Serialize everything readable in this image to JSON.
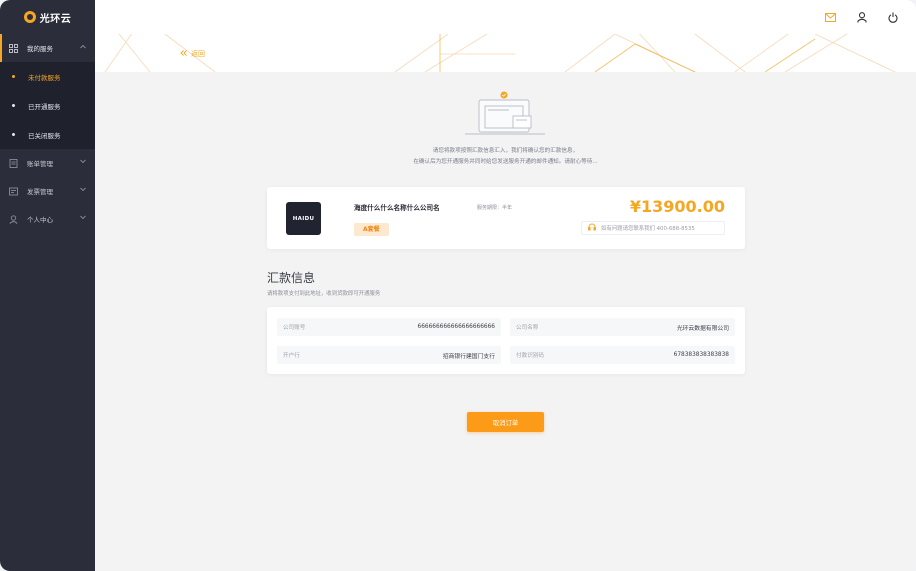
{
  "app": {
    "logo_text": "光环云"
  },
  "sidebar": {
    "groups": [
      {
        "label": "我的服务",
        "icon": "grid-icon",
        "open": true,
        "items": [
          {
            "label": "未付款服务",
            "active": true
          },
          {
            "label": "已开通服务",
            "active": false
          },
          {
            "label": "已关闭服务",
            "active": false
          }
        ]
      },
      {
        "label": "账单管理",
        "icon": "bill-icon",
        "open": false
      },
      {
        "label": "发票管理",
        "icon": "invoice-icon",
        "open": false
      },
      {
        "label": "个人中心",
        "icon": "user-icon",
        "open": false
      }
    ]
  },
  "topbar": {
    "icons": [
      "mail-icon",
      "user-icon",
      "power-icon"
    ]
  },
  "banner": {
    "back_label": "返回"
  },
  "notice": {
    "line1": "请您将款项按照汇款信息汇入，我们将确认您的汇款信息，",
    "line2": "在确认后为您开通服务并同时给您发送服务开通的邮件通知。请耐心等待..."
  },
  "order": {
    "logo_text": "HAIDU",
    "product_name": "海度什么什么名称什么公司名",
    "period": "服务期限：半年",
    "package": "A套餐",
    "price": "¥13900.00",
    "help": "如有问题请您联系我们 400-688-8535"
  },
  "payment": {
    "title": "汇款信息",
    "subtitle": "请将款项支付到此地址，收到货款即可开通服务",
    "fields": [
      {
        "label": "公司账号",
        "value": "666666666666666666666"
      },
      {
        "label": "公司名称",
        "value": "光环云数据有限公司"
      },
      {
        "label": "开户行",
        "value": "招商银行建国门支行"
      },
      {
        "label": "付款识别码",
        "value": "678383838383838"
      }
    ]
  },
  "actions": {
    "cancel_label": "取消订单"
  },
  "colors": {
    "accent": "#f5a623",
    "sidebar": "#2b2d3a",
    "button": "#fb9b17"
  }
}
